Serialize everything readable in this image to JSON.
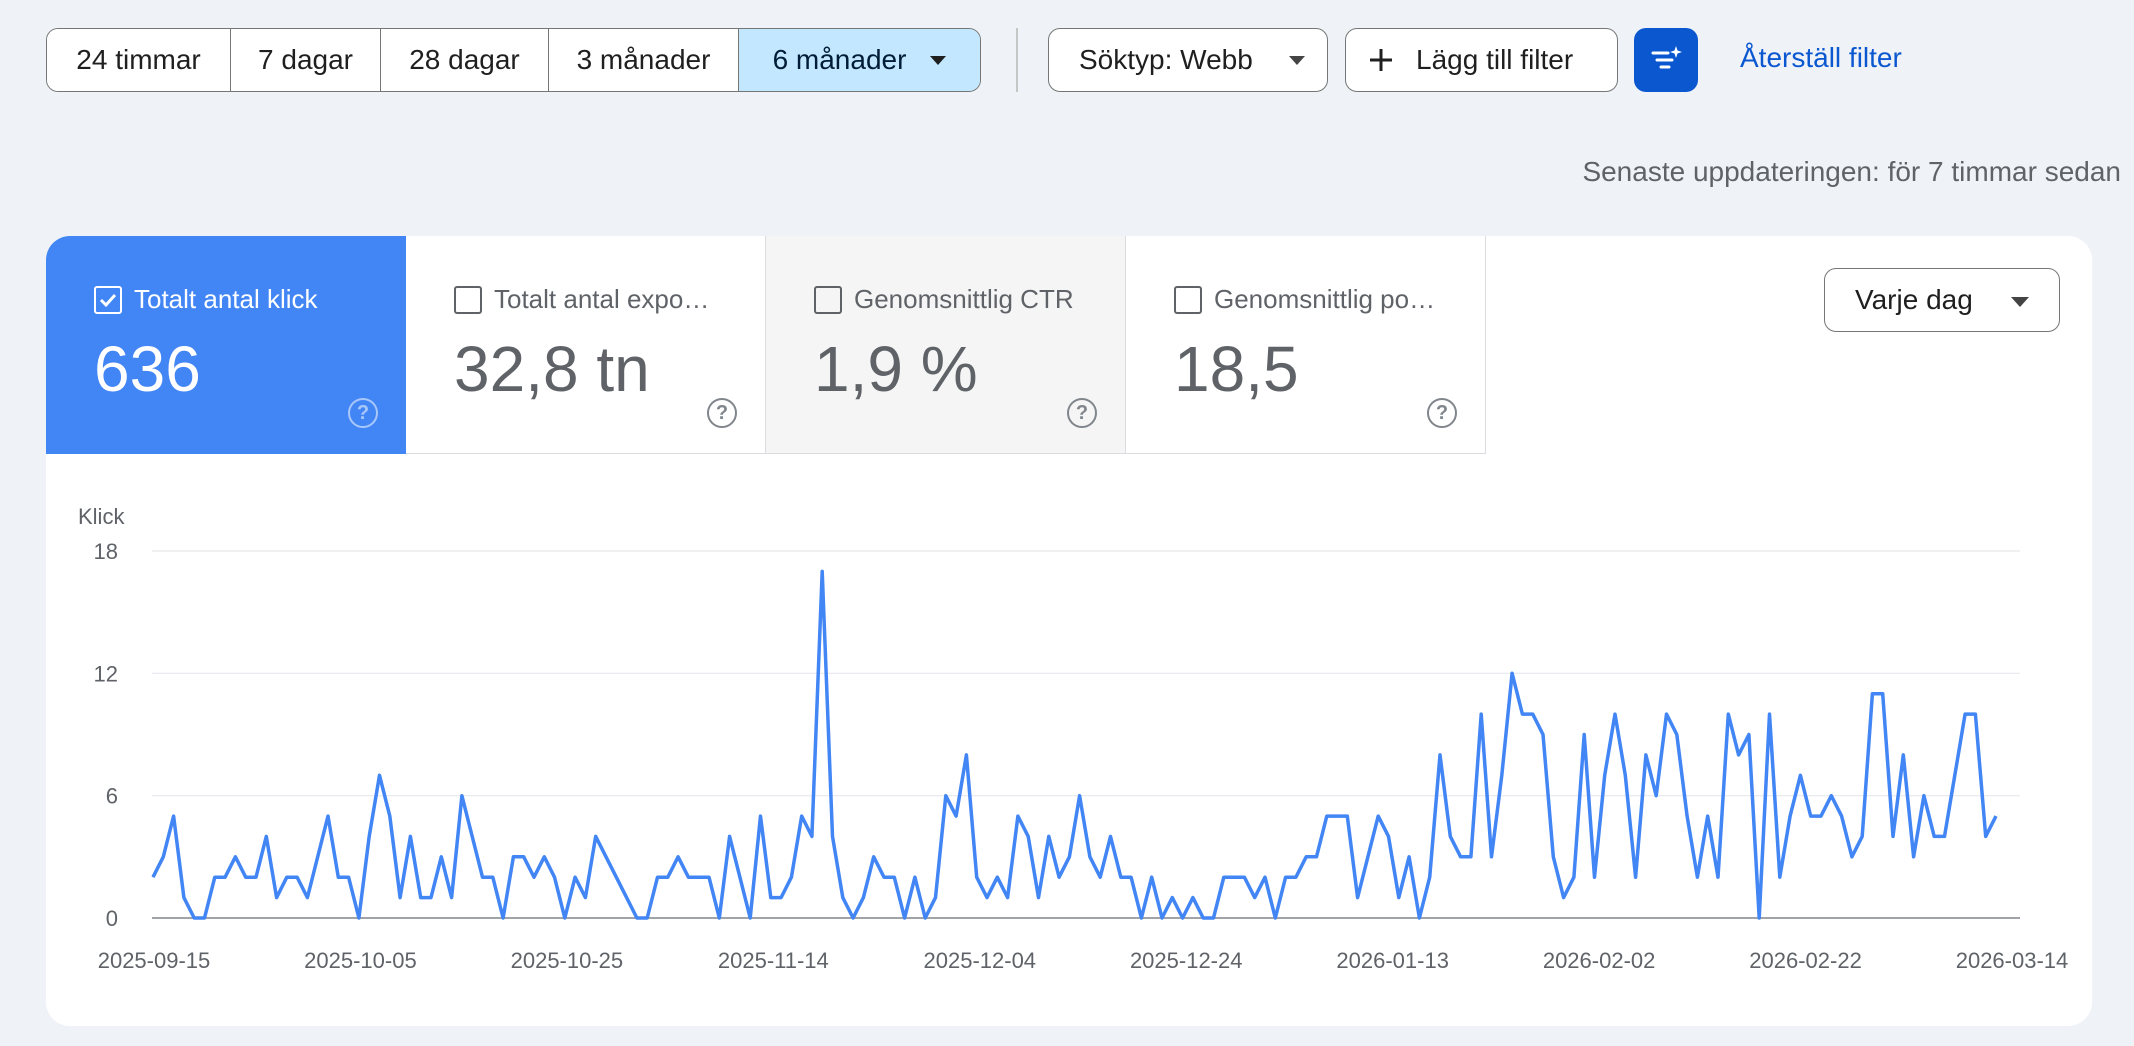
{
  "toolbar": {
    "ranges": [
      {
        "label": "24 timmar",
        "active": false
      },
      {
        "label": "7 dagar",
        "active": false
      },
      {
        "label": "28 dagar",
        "active": false
      },
      {
        "label": "3 månader",
        "active": false
      },
      {
        "label": "6 månader",
        "active": true
      }
    ],
    "search_type": "Söktyp: Webb",
    "add_filter": "Lägg till filter",
    "reset_filter": "Återställ filter"
  },
  "last_updated": "Senaste uppdateringen: för 7 timmar sedan",
  "metrics": [
    {
      "label": "Totalt antal klick",
      "value": "636",
      "checked": true
    },
    {
      "label": "Totalt antal expo…",
      "value": "32,8 tn",
      "checked": false
    },
    {
      "label": "Genomsnittlig CTR",
      "value": "1,9 %",
      "checked": false
    },
    {
      "label": "Genomsnittlig po…",
      "value": "18,5",
      "checked": false
    }
  ],
  "aggregation": "Varje dag",
  "colors": {
    "accent": "#4285f4",
    "primary": "#0b57d0",
    "selected_range": "#c2e7ff"
  },
  "chart_data": {
    "type": "line",
    "ylabel": "Klick",
    "ylim": [
      0,
      18
    ],
    "yticks": [
      0,
      6,
      12,
      18
    ],
    "xtick_labels": [
      "2025-09-15",
      "2025-10-05",
      "2025-10-25",
      "2025-11-14",
      "2025-12-04",
      "2025-12-24",
      "2026-01-13",
      "2026-02-02",
      "2026-02-22",
      "2026-03-14"
    ],
    "x_start": "2025-09-15",
    "x_end": "2026-03-14",
    "grid": true,
    "series": [
      {
        "values": [
          2,
          3,
          5,
          1,
          0,
          0,
          2,
          2,
          3,
          2,
          2,
          4,
          1,
          2,
          2,
          1,
          3,
          5,
          2,
          2,
          0,
          4,
          7,
          5,
          1,
          4,
          1,
          1,
          3,
          1,
          6,
          4,
          2,
          2,
          0,
          3,
          3,
          2,
          3,
          2,
          0,
          2,
          1,
          4,
          3,
          2,
          1,
          0,
          0,
          2,
          2,
          3,
          2,
          2,
          2,
          0,
          4,
          2,
          0,
          5,
          1,
          1,
          2,
          5,
          4,
          17,
          4,
          1,
          0,
          1,
          3,
          2,
          2,
          0,
          2,
          0,
          1,
          6,
          5,
          8,
          2,
          1,
          2,
          1,
          5,
          4,
          1,
          4,
          2,
          3,
          6,
          3,
          2,
          4,
          2,
          2,
          0,
          2,
          0,
          1,
          0,
          1,
          0,
          0,
          2,
          2,
          2,
          1,
          2,
          0,
          2,
          2,
          3,
          3,
          5,
          5,
          5,
          1,
          3,
          5,
          4,
          1,
          3,
          0,
          2,
          8,
          4,
          3,
          3,
          10,
          3,
          7,
          12,
          10,
          10,
          9,
          3,
          1,
          2,
          9,
          2,
          7,
          10,
          7,
          2,
          8,
          6,
          10,
          9,
          5,
          2,
          5,
          2,
          10,
          8,
          9,
          0,
          10,
          2,
          5,
          7,
          5,
          5,
          6,
          5,
          3,
          4,
          11,
          11,
          4,
          8,
          3,
          6,
          4,
          4,
          7,
          10,
          10,
          4,
          5
        ]
      }
    ]
  }
}
